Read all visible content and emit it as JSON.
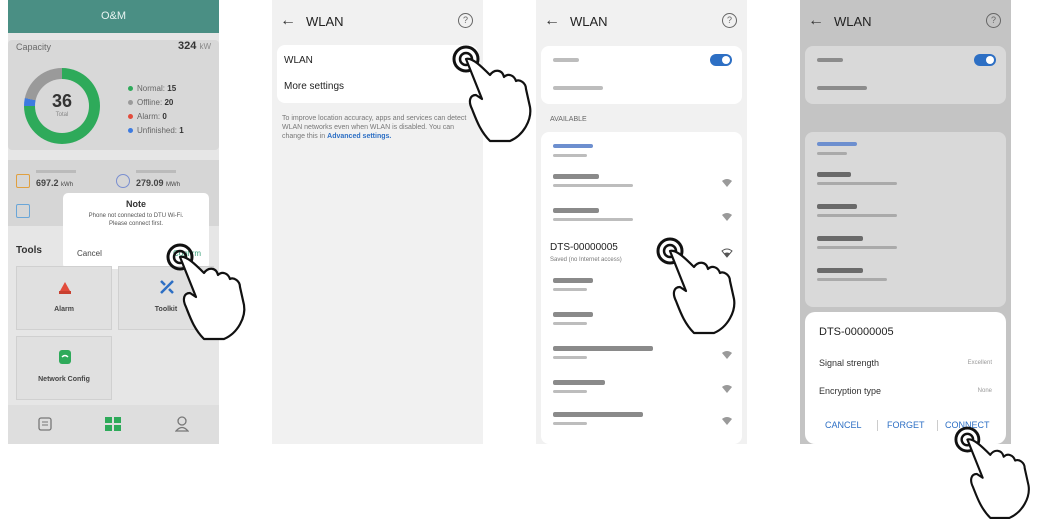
{
  "panel1": {
    "header_title": "O&M",
    "capacity_label": "Capacity",
    "capacity_value": "324",
    "capacity_unit": "kW",
    "total_devices": "36",
    "total_label": "Total",
    "legend": [
      {
        "label": "Normal:",
        "value": "15",
        "color": "#2eaa5a"
      },
      {
        "label": "Offline:",
        "value": "20",
        "color": "#9a9a9a"
      },
      {
        "label": "Alarm:",
        "value": "0",
        "color": "#e24c3c"
      },
      {
        "label": "Unfinished:",
        "value": "1",
        "color": "#3d7be0"
      }
    ],
    "stat_1_value": "697.2",
    "stat_1_unit": "kWh",
    "stat_2_value": "279.09",
    "stat_2_unit": "MWh",
    "dialog": {
      "title": "Note",
      "message_line1": "Phone not connected to DTU Wi-Fi.",
      "message_line2": "Please connect first.",
      "cancel_label": "Cancel",
      "confirm_label": "Confirm"
    },
    "tools_label": "Tools",
    "tools": [
      "Alarm",
      "Toolkit",
      "Network Config"
    ]
  },
  "panel2": {
    "title": "WLAN",
    "row_wlan": "WLAN",
    "row_more": "More settings",
    "info_text": "To improve location accuracy, apps and services can detect WLAN networks even when WLAN is disabled. You can change this in",
    "info_link": "Advanced settings."
  },
  "panel3": {
    "title": "WLAN",
    "available_label": "AVAILABLE",
    "selected_network": "DTS-00000005",
    "selected_status": "Saved (no Internet access)"
  },
  "panel4": {
    "title": "WLAN",
    "sheet_title": "DTS-00000005",
    "signal_label": "Signal strength",
    "signal_value": "Excellent",
    "encryption_label": "Encryption type",
    "encryption_value": "None",
    "cancel_label": "CANCEL",
    "forget_label": "FORGET",
    "connect_label": "CONNECT"
  },
  "colors": {
    "teal_header": "#4a8f84",
    "accent_blue": "#2d6fc4",
    "ring_green": "#2eaa5a",
    "alarm_red": "#e24c3c"
  }
}
